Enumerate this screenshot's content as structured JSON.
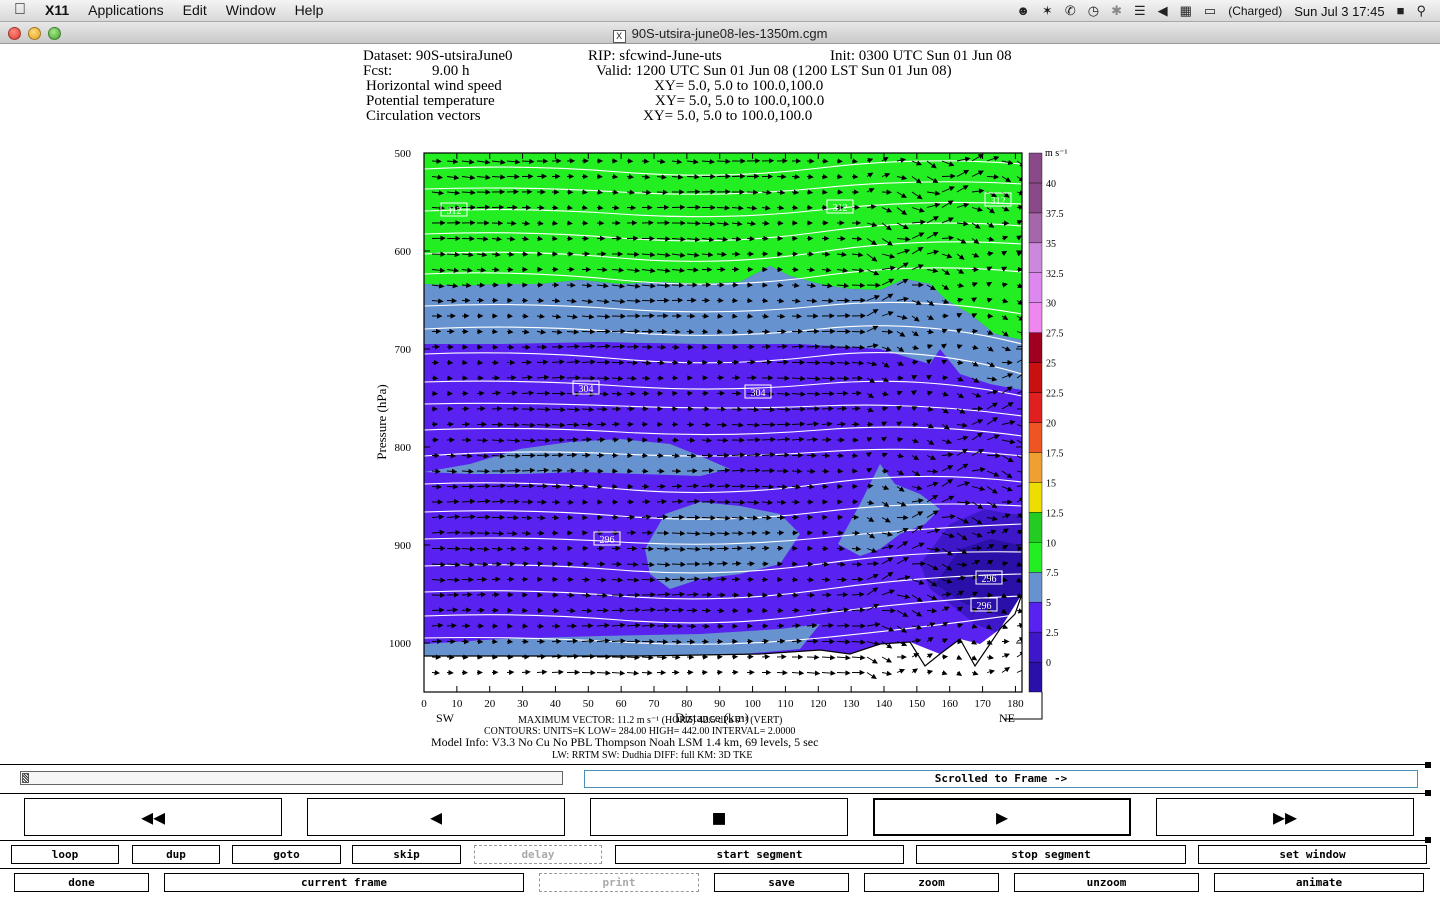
{
  "menubar": {
    "app_name": "X11",
    "items": [
      "Applications",
      "Edit",
      "Window",
      "Help"
    ],
    "battery_status": "(Charged)",
    "clock": "Sun Jul 3  17:45"
  },
  "window": {
    "title": "90S-utsira-june08-les-1350m.cgm"
  },
  "plot": {
    "header": {
      "dataset": "Dataset: 90S-utsiraJune0",
      "rip": "RIP: sfcwind-June-uts",
      "init": "Init: 0300 UTC Sun 01 Jun 08",
      "fcst_label": "Fcst:",
      "fcst_value": "9.00 h",
      "valid": "Valid: 1200 UTC Sun 01 Jun 08 (1200 LST Sun 01 Jun 08)",
      "fields": [
        {
          "name": "Horizontal wind speed",
          "xy": "XY=   5.0,   5.0 to 100.0,100.0"
        },
        {
          "name": "Potential temperature",
          "xy": "XY=   5.0,   5.0 to 100.0,100.0"
        },
        {
          "name": "Circulation vectors",
          "xy": "XY=   5.0,   5.0 to 100.0,100.0"
        }
      ]
    },
    "y_axis_label": "Pressure (hPa)",
    "x_axis_label": "Distance (km)",
    "sw_label": "SW",
    "ne_label": "NE",
    "colorbar_unit": "m s⁻¹",
    "contour_labels": [
      {
        "text": "312",
        "pos": [
          30,
          58
        ]
      },
      {
        "text": "312",
        "pos": [
          416,
          55
        ]
      },
      {
        "text": "312",
        "pos": [
          574,
          48
        ]
      },
      {
        "text": "304",
        "pos": [
          162,
          236
        ]
      },
      {
        "text": "304",
        "pos": [
          334,
          240
        ]
      },
      {
        "text": "296",
        "pos": [
          183,
          387
        ]
      },
      {
        "text": "296",
        "pos": [
          565,
          426
        ]
      },
      {
        "text": "296",
        "pos": [
          560,
          453
        ]
      }
    ],
    "footer": {
      "line1": "MAXIMUM VECTOR:  11.2 m s⁻¹ (HORZ)        42.5 dPa s⁻¹ (VERT)",
      "line2": "CONTOURS:  UNITS=K  LOW=  284.00          HIGH=  442.00          INTERVAL=    2.0000",
      "line3": "Model Info: V3.3        No Cu      No PBL      Thompson        Noah LSM   1.4 km,   69 levels,      5 sec",
      "line4": "LW: RRTM  SW: Dudhia   DIFF: full     KM: 3D TKE"
    }
  },
  "chart_data": {
    "type": "heatmap",
    "title": "",
    "xlabel": "Distance (km)",
    "ylabel": "Pressure (hPa)",
    "xlim": [
      0,
      182
    ],
    "ylim": [
      1050,
      500
    ],
    "x_ticks": [
      0,
      10,
      20,
      30,
      40,
      50,
      60,
      70,
      80,
      90,
      100,
      110,
      120,
      130,
      140,
      150,
      160,
      170,
      180
    ],
    "y_ticks": [
      500,
      600,
      700,
      800,
      900,
      1000
    ],
    "colorbar": {
      "levels": [
        0,
        2.5,
        5,
        7.5,
        10,
        12.5,
        15,
        17.5,
        20,
        22.5,
        25,
        27.5,
        30,
        32.5,
        35,
        37.5,
        40
      ],
      "colors": [
        "#2a10a8",
        "#3e18c8",
        "#5a22f0",
        "#6693d0",
        "#22ee22",
        "#22cc22",
        "#eedd00",
        "#f0a030",
        "#ee5522",
        "#e02020",
        "#c81010",
        "#a00020",
        "#ee88ee",
        "#dd88ee",
        "#cc88dd",
        "#a666aa",
        "#8a4a8a"
      ]
    },
    "contour_units": "K",
    "contour_low": 284.0,
    "contour_high": 442.0,
    "contour_interval": 2.0,
    "max_vector_horz": 11.2,
    "max_vector_vert": 42.5
  },
  "controls": {
    "status_text": "Scrolled to Frame ->",
    "play_buttons": [
      {
        "name": "rewind-button",
        "glyph": "◀◀"
      },
      {
        "name": "step-back-button",
        "glyph": "◀"
      },
      {
        "name": "stop-button",
        "glyph": "■"
      },
      {
        "name": "play-button",
        "glyph": "▶"
      },
      {
        "name": "fast-forward-button",
        "glyph": "▶▶"
      }
    ],
    "row1": [
      "loop",
      "dup",
      "goto",
      "skip",
      "delay",
      "start segment",
      "stop segment",
      "set window"
    ],
    "row2": [
      "done",
      "current frame",
      "print",
      "save",
      "zoom",
      "unzoom",
      "animate"
    ]
  }
}
